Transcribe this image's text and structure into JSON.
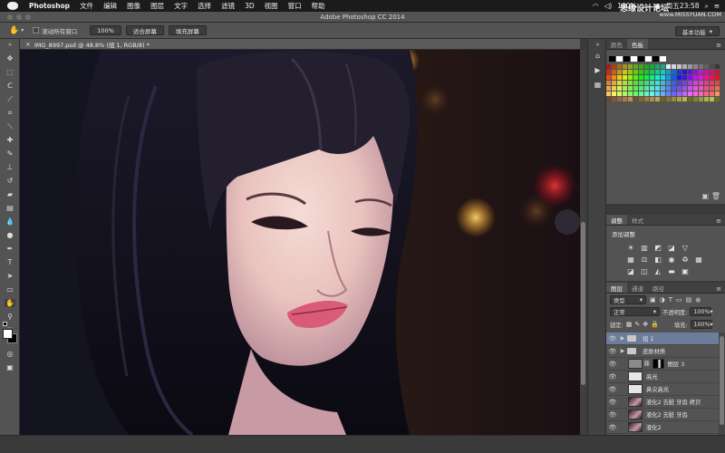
{
  "menubar": {
    "app_name": "Photoshop",
    "items": [
      "文件",
      "编辑",
      "图像",
      "图层",
      "文字",
      "选择",
      "滤镜",
      "3D",
      "视图",
      "窗口",
      "帮助"
    ],
    "battery": "100%",
    "clock": "周五23:58"
  },
  "window": {
    "title": "Adobe Photoshop CC 2014"
  },
  "options_bar": {
    "scroll_all_windows": "滚动所有窗口",
    "zoom_value": "100%",
    "fit_screen": "适合屏幕",
    "fill_screen": "填充屏幕",
    "workspace": "基本功能"
  },
  "document": {
    "tab_title": "IMG_8997.psd @ 48.8% (组 1, RGB/8) *"
  },
  "swatches_panel": {
    "tabs": [
      "颜色",
      "色板"
    ],
    "active_tab": "色板"
  },
  "adjustments_panel": {
    "tabs": [
      "调整",
      "样式"
    ],
    "active_tab": "调整",
    "heading": "添加调整"
  },
  "layers_panel": {
    "tabs": [
      "图层",
      "通道",
      "路径"
    ],
    "active_tab": "图层",
    "filter_kind": "类型",
    "blend_mode": "正常",
    "opacity_label": "不透明度:",
    "opacity_value": "100%",
    "lock_label": "锁定:",
    "fill_label": "填充:",
    "fill_value": "100%",
    "layers": [
      {
        "name": "组 1",
        "kind": "group",
        "visible": true,
        "selected": true
      },
      {
        "name": "皮肤材质",
        "kind": "group",
        "visible": true,
        "selected": false
      },
      {
        "name": "图层 3",
        "kind": "masked",
        "visible": true,
        "selected": false
      },
      {
        "name": "高光",
        "kind": "light",
        "visible": true,
        "selected": false
      },
      {
        "name": "鼻尖高光",
        "kind": "light",
        "visible": true,
        "selected": false
      },
      {
        "name": "液化2 去脏 牙齿 拷贝",
        "kind": "photo",
        "visible": true,
        "selected": false
      },
      {
        "name": "液化2 去脏 牙齿",
        "kind": "photo",
        "visible": true,
        "selected": false
      },
      {
        "name": "液化2",
        "kind": "photo",
        "visible": true,
        "selected": false
      }
    ]
  },
  "watermark": {
    "text": "思缘设计论坛",
    "url": "www.MISSYUAN.COM"
  }
}
